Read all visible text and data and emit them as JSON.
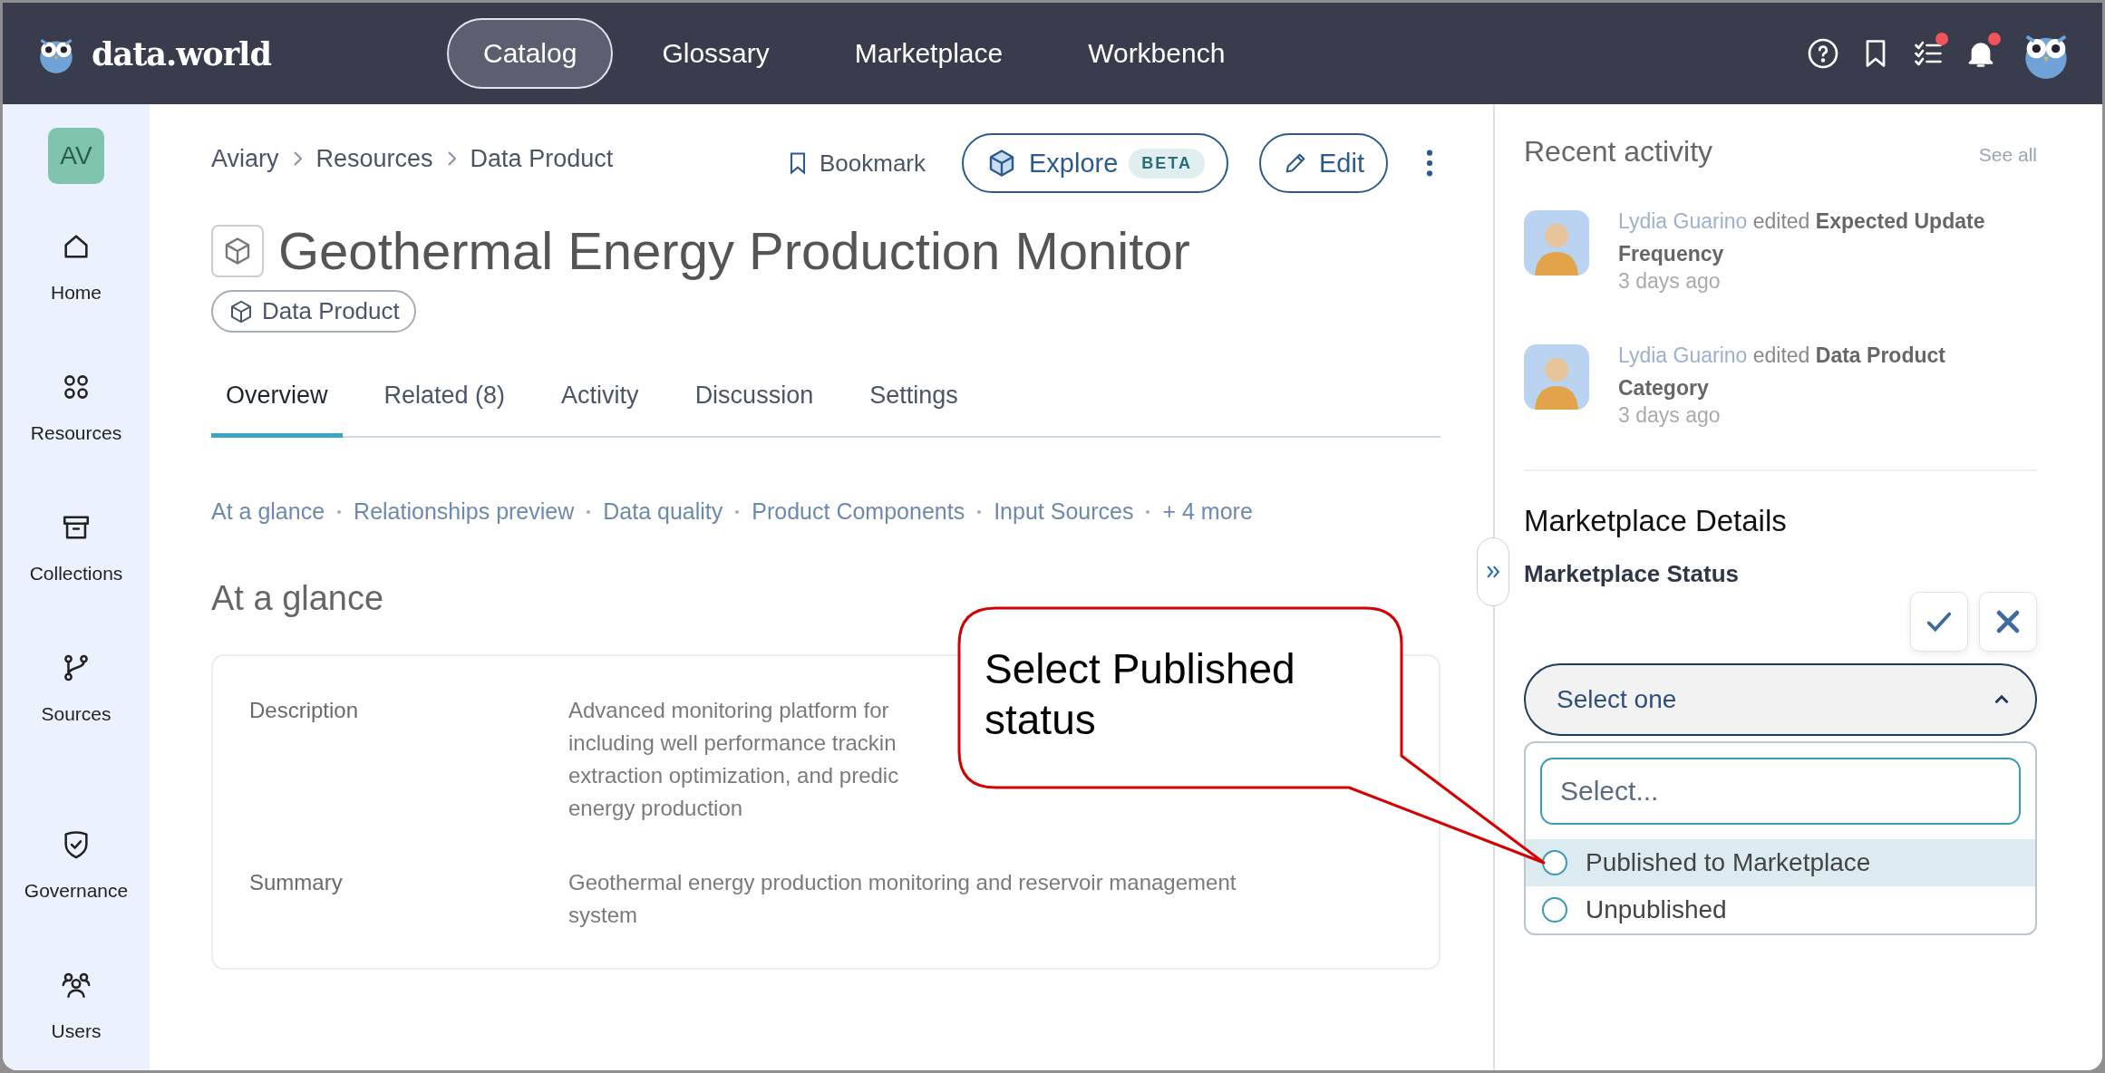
{
  "topbar": {
    "logo": "data.world",
    "nav": [
      {
        "label": "Catalog",
        "selected": true
      },
      {
        "label": "Glossary",
        "selected": false
      },
      {
        "label": "Marketplace",
        "selected": false
      },
      {
        "label": "Workbench",
        "selected": false
      }
    ],
    "icons": [
      {
        "kind": "help",
        "dot": false
      },
      {
        "kind": "bookmark",
        "dot": false
      },
      {
        "kind": "tasks",
        "dot": true
      },
      {
        "kind": "bell",
        "dot": true
      }
    ]
  },
  "sidebar": {
    "badge": "AV",
    "items": [
      {
        "kind": "home",
        "label": "Home"
      },
      {
        "kind": "resources",
        "label": "Resources"
      },
      {
        "kind": "collections",
        "label": "Collections"
      },
      {
        "kind": "sources",
        "label": "Sources"
      },
      {
        "kind": "governance",
        "label": "Governance"
      },
      {
        "kind": "users",
        "label": "Users"
      }
    ]
  },
  "breadcrumbs": [
    "Aviary",
    "Resources",
    "Data Product"
  ],
  "actions": {
    "bookmark": "Bookmark",
    "explore": "Explore",
    "explore_badge": "BETA",
    "edit": "Edit"
  },
  "title": "Geothermal Energy Production Monitor",
  "type_chip": "Data Product",
  "tabs": [
    {
      "label": "Overview",
      "selected": true
    },
    {
      "label": "Related (8)",
      "selected": false
    },
    {
      "label": "Activity",
      "selected": false
    },
    {
      "label": "Discussion",
      "selected": false
    },
    {
      "label": "Settings",
      "selected": false
    }
  ],
  "section_links": [
    "At a glance",
    "Relationships preview",
    "Data quality",
    "Product Components",
    "Input Sources",
    "+ 4 more"
  ],
  "glance": {
    "heading": "At a glance",
    "rows": [
      {
        "label": "Description",
        "lines": [
          "Advanced monitoring platform for",
          "including well performance trackin",
          "extraction optimization, and predic",
          "energy production"
        ]
      },
      {
        "label": "Summary",
        "lines": [
          "Geothermal energy production monitoring and reservoir management",
          "system"
        ]
      }
    ]
  },
  "callout": {
    "text": "Select Published status"
  },
  "recent_activity": {
    "title": "Recent activity",
    "see_all": "See all",
    "items": [
      {
        "user": "Lydia Guarino",
        "verb": "edited",
        "field": "Expected Update Frequency",
        "time": "3 days ago"
      },
      {
        "user": "Lydia Guarino",
        "verb": "edited",
        "field": "Data Product Category",
        "time": "3 days ago"
      }
    ]
  },
  "marketplace": {
    "title": "Marketplace Details",
    "status_label": "Marketplace Status",
    "select": {
      "value": "Select one",
      "expanded": true
    },
    "search": {
      "placeholder": "Select..."
    },
    "options": [
      {
        "label": "Published to Marketplace",
        "selected": false,
        "hovered": true
      },
      {
        "label": "Unpublished",
        "selected": false,
        "hovered": false
      }
    ]
  }
}
